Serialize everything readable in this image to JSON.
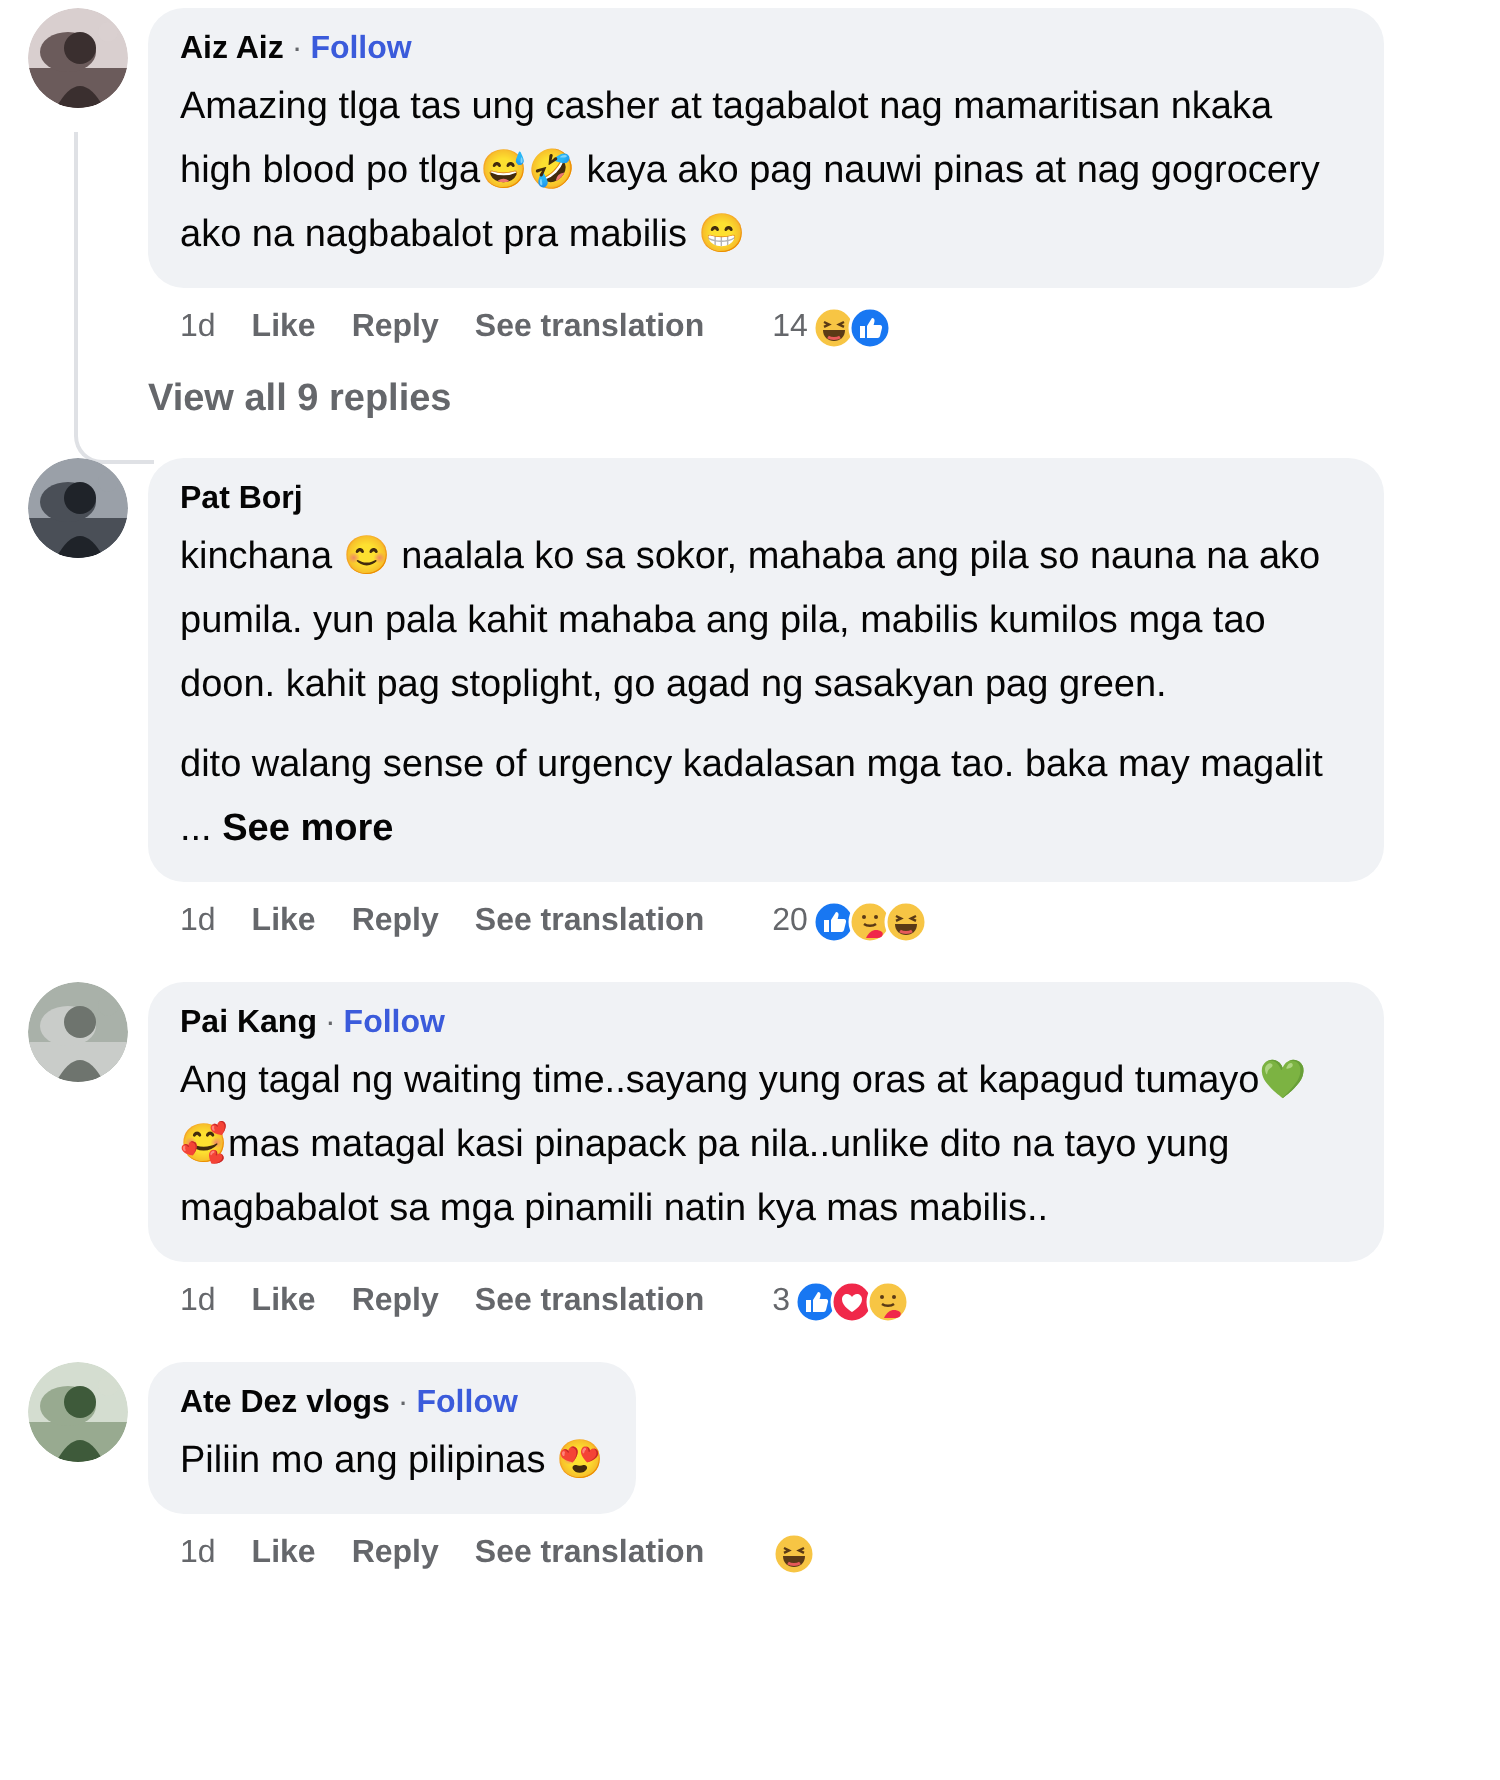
{
  "comments": [
    {
      "author": "Aiz Aiz",
      "follow": {
        "separator": "·",
        "label": "Follow"
      },
      "body": [
        "Amazing tlga tas ung casher at tagabalot nag mamaritisan nkaka high blood po tlga😅🤣 kaya ako pag nauwi pinas at nag gogrocery ako na nagbabalot pra mabilis 😁"
      ],
      "time": "1d",
      "like": "Like",
      "reply": "Reply",
      "translate": "See translation",
      "count": "14",
      "reactions": [
        {
          "kind": "haha"
        },
        {
          "kind": "like"
        }
      ],
      "thread": {
        "label": "View all 9 replies"
      }
    },
    {
      "author": "Pat Borj",
      "body": [
        "kinchana 😊 naalala ko sa sokor, mahaba ang pila so nauna na ako pumila. yun pala kahit mahaba ang pila, mabilis kumilos mga tao doon. kahit pag stoplight, go agad ng sasakyan pag green.",
        "dito walang sense of urgency kadalasan mga tao. baka may magalit ..."
      ],
      "see_more": "See more",
      "time": "1d",
      "like": "Like",
      "reply": "Reply",
      "translate": "See translation",
      "count": "20",
      "reactions": [
        {
          "kind": "like"
        },
        {
          "kind": "care"
        },
        {
          "kind": "haha"
        }
      ]
    },
    {
      "author": "Pai Kang",
      "follow": {
        "separator": "·",
        "label": "Follow"
      },
      "body": [
        "Ang tagal ng waiting time..sayang yung oras at kapagud tumayo💚🥰mas matagal kasi pinapack pa nila..unlike dito na tayo yung magbabalot sa mga pinamili natin kya mas mabilis.."
      ],
      "time": "1d",
      "like": "Like",
      "reply": "Reply",
      "translate": "See translation",
      "count": "3",
      "reactions": [
        {
          "kind": "like"
        },
        {
          "kind": "love"
        },
        {
          "kind": "care"
        }
      ]
    },
    {
      "author": "Ate Dez vlogs",
      "follow": {
        "separator": "·",
        "label": "Follow"
      },
      "body": [
        "Piliin mo ang pilipinas 😍"
      ],
      "time": "1d",
      "like": "Like",
      "reply": "Reply",
      "translate": "See translation",
      "reactions": [
        {
          "kind": "haha"
        }
      ]
    }
  ]
}
